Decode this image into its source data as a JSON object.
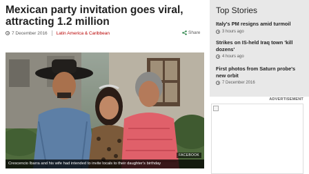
{
  "article": {
    "headline": "Mexican party invitation goes viral, attracting 1.2 million",
    "date": "7 December 2016",
    "category": "Latin America & Caribbean",
    "share_label": "Share",
    "image_caption": "Crescencio Ibarra and his wife had intended to invite locals to their daughter's birthday",
    "image_credit": "FACEBOOK"
  },
  "sidebar": {
    "title": "Top Stories",
    "stories": [
      {
        "title": "Italy's PM resigns amid turmoil",
        "time": "3 hours ago"
      },
      {
        "title": "Strikes on IS-held Iraq town 'kill dozens'",
        "time": "4 hours ago"
      },
      {
        "title": "First photos from Saturn probe's new orbit",
        "time": "7 December 2016"
      }
    ]
  },
  "advertisement": {
    "label": "ADVERTISEMENT"
  },
  "colors": {
    "category": "#b80000",
    "sidebar_bg": "#e8e8e8",
    "share_icon": "#1a7a3a"
  }
}
